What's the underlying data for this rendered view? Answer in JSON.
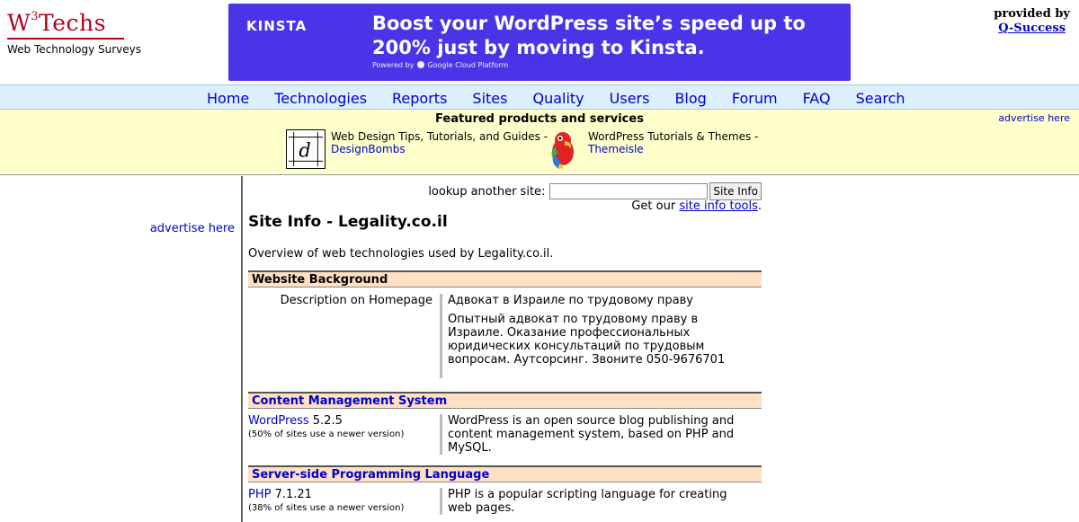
{
  "logo": {
    "name": "W³Techs",
    "name_main": "W",
    "name_sup": "3",
    "name_rest": "Techs",
    "tagline": "Web Technology Surveys"
  },
  "banner": {
    "brand": "KINSTA",
    "headline": "Boost your WordPress site’s speed up to 200% just by moving to Kinsta.",
    "powered_prefix": "Powered by",
    "powered_brand": "Google Cloud Platform"
  },
  "provided": {
    "label": "provided by",
    "company": "Q-Success"
  },
  "nav": [
    "Home",
    "Technologies",
    "Reports",
    "Sites",
    "Quality",
    "Users",
    "Blog",
    "Forum",
    "FAQ",
    "Search"
  ],
  "featured": {
    "title": "Featured products and services",
    "advertise": "advertise here",
    "items": [
      {
        "text": "Web Design Tips, Tutorials, and Guides -",
        "link": "DesignBombs",
        "icon": "designbombs-logo",
        "icon_letter": "d"
      },
      {
        "text": "WordPress Tutorials & Themes -",
        "link": "Themeisle",
        "icon": "themeisle-parrot"
      }
    ]
  },
  "left": {
    "advertise": "advertise here"
  },
  "lookup": {
    "label": "lookup another site:",
    "input_value": "",
    "button": "Site Info",
    "tools_prefix": "Get our",
    "tools_link": "site info tools",
    "tools_suffix": "."
  },
  "page": {
    "title": "Site Info - Legality.co.il",
    "overview": "Overview of web technologies used by Legality.co.il."
  },
  "sections": {
    "background": {
      "title": "Website Background",
      "label": "Description on Homepage",
      "value_title": "Адвокат в Израиле по трудовому праву",
      "value_desc": "Опытный адвокат по трудовому праву в Израиле. Оказание профессиональных юридических консультаций по трудовым вопросам. Аутсорсинг. Звоните 050-9676701"
    },
    "cms": {
      "title": "Content Management System",
      "tech": "WordPress",
      "version": "5.2.5",
      "note": "(50% of sites use a newer version)",
      "desc": "WordPress is an open source blog publishing and content management system, based on PHP and MySQL."
    },
    "lang": {
      "title": "Server-side Programming Language",
      "tech": "PHP",
      "version": "7.1.21",
      "note": "(38% of sites use a newer version)",
      "desc": "PHP is a popular scripting language for creating web pages."
    }
  },
  "colors": {
    "brand_red": "#b5001f",
    "banner_bg": "#4b34e8",
    "nav_bg": "#ddeeff",
    "featured_bg": "#ffffcc",
    "section_bg": "#ffe0c2",
    "link": "#0000cc"
  }
}
